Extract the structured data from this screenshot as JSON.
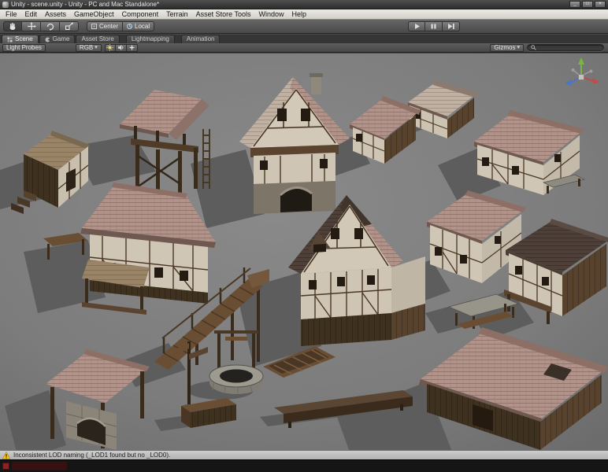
{
  "window": {
    "title": "Unity - scene.unity - Unity - PC and Mac Standalone*",
    "controls": {
      "minimize": "_",
      "maximize": "□",
      "close": "×"
    }
  },
  "menubar": {
    "items": [
      "File",
      "Edit",
      "Assets",
      "GameObject",
      "Component",
      "Terrain",
      "Asset Store Tools",
      "Window",
      "Help"
    ]
  },
  "toolbar": {
    "tools": [
      "hand-tool",
      "move-tool",
      "rotate-tool",
      "scale-tool"
    ],
    "pivot": {
      "label": "Center"
    },
    "space": {
      "label": "Local"
    },
    "playback": [
      "play",
      "pause",
      "step"
    ]
  },
  "tabs": [
    {
      "label": "Scene",
      "active": true
    },
    {
      "label": "Game",
      "active": false
    },
    {
      "label": "Asset Store",
      "active": false
    },
    {
      "label": "Lightmapping",
      "active": false
    },
    {
      "label": "Animation",
      "active": false
    }
  ],
  "scene_toolbar": {
    "mode": "Light Probes",
    "channel": "RGB",
    "gizmos": "Gizmos",
    "search_placeholder": ""
  },
  "icons": {
    "dropdown_arrow": "▾"
  },
  "statusbar": {
    "warning": "Inconsistent LOD naming (_LOD1 found but no _LOD0)."
  },
  "colors": {
    "warning_yellow": "#f2c41d",
    "axis_x_red": "#c24b4b",
    "axis_y_green": "#76b93a",
    "axis_z_blue": "#4a76c4",
    "viewport_gray": "#7d7d7d"
  }
}
